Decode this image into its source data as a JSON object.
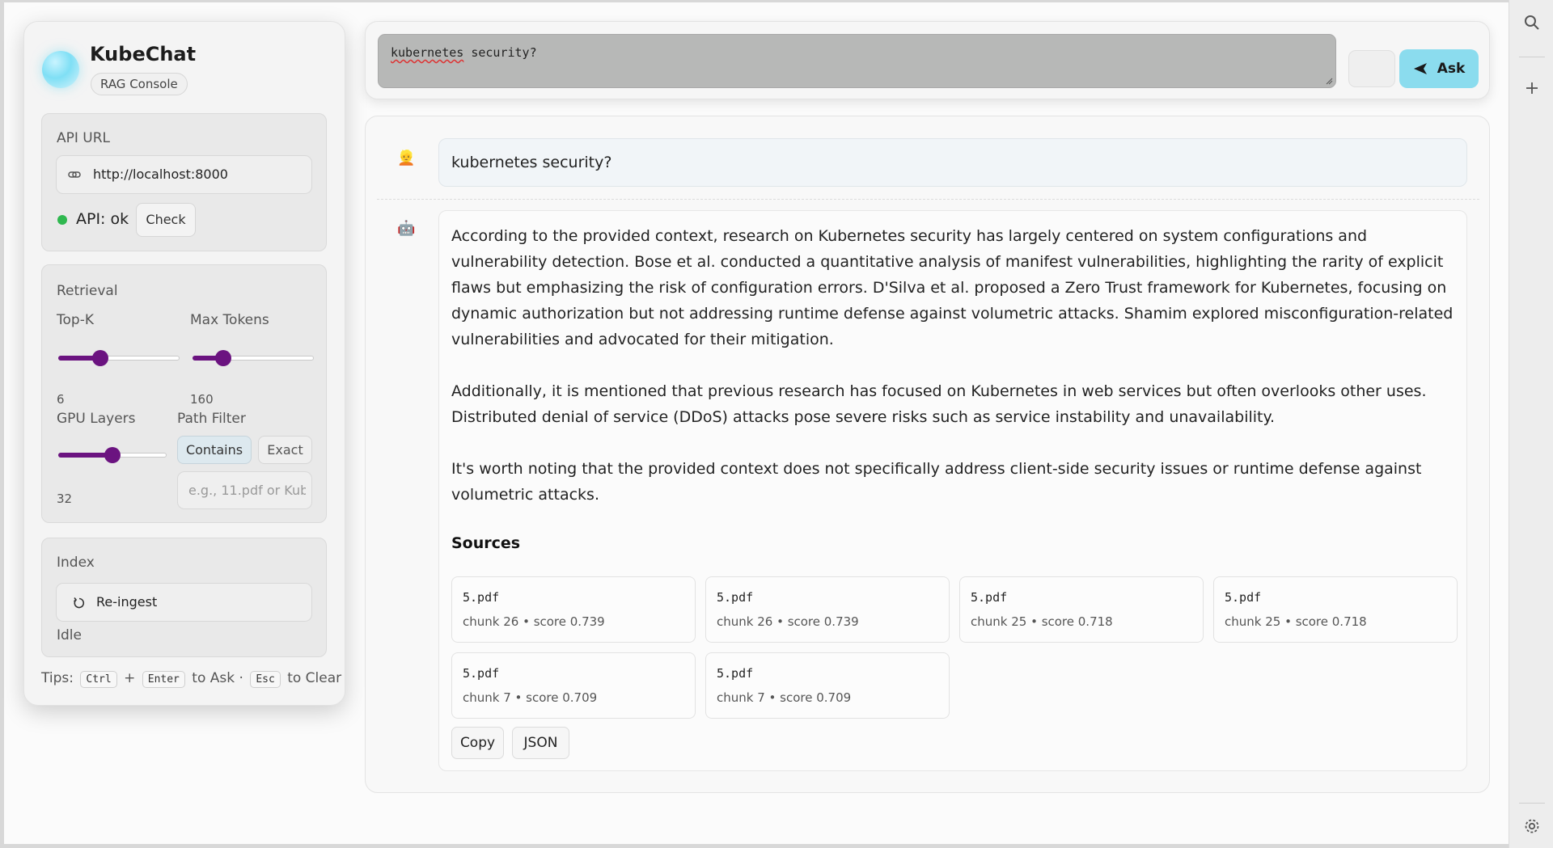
{
  "brand": {
    "title": "KubeChat",
    "badge": "RAG Console"
  },
  "api": {
    "section_title": "API URL",
    "url": "http://localhost:8000",
    "status": "API: ok",
    "status_color": "#2fb84f",
    "check_label": "Check"
  },
  "retrieval": {
    "section_title": "Retrieval",
    "topk": {
      "label": "Top-K",
      "value": "6",
      "level": 0.35
    },
    "max_tokens": {
      "label": "Max Tokens",
      "value": "160",
      "level": 0.25
    },
    "gpu_layers": {
      "label": "GPU Layers",
      "value": "32",
      "level": 0.5
    },
    "path_filter": {
      "label": "Path Filter",
      "contains_label": "Contains",
      "exact_label": "Exact",
      "placeholder": "e.g., 11.pdf or Kub"
    }
  },
  "index": {
    "section_title": "Index",
    "reingest_label": "Re-ingest",
    "status": "Idle"
  },
  "tips": {
    "prefix": "Tips:",
    "key1": "Ctrl",
    "plus": "+",
    "key2": "Enter",
    "ask_text": "to Ask ·",
    "key3": "Esc",
    "clear_text": "to Clear"
  },
  "query": {
    "word1": "kubernetes",
    "word2": " security?"
  },
  "ask_label": "Ask",
  "chat": {
    "user_message": "kubernetes security?",
    "answer": [
      "According to the provided context, research on Kubernetes security has largely centered on system configurations and vulnerability detection. Bose et al. conducted a quantitative analysis of manifest vulnerabilities, highlighting the rarity of explicit flaws but emphasizing the risk of configuration errors. D'Silva et al. proposed a Zero Trust framework for Kubernetes, focusing on dynamic authorization but not addressing runtime defense against volumetric attacks. Shamim explored misconfiguration-related vulnerabilities and advocated for their mitigation.",
      "Additionally, it is mentioned that previous research has focused on Kubernetes in web services but often overlooks other uses. Distributed denial of service (DDoS) attacks pose severe risks such as service instability and unavailability.",
      "It's worth noting that the provided context does not specifically address client-side security issues or runtime defense against volumetric attacks."
    ],
    "sources_title": "Sources",
    "sources": [
      {
        "file": "5.pdf",
        "meta": "chunk 26 • score 0.739"
      },
      {
        "file": "5.pdf",
        "meta": "chunk 26 • score 0.739"
      },
      {
        "file": "5.pdf",
        "meta": "chunk 25 • score 0.718"
      },
      {
        "file": "5.pdf",
        "meta": "chunk 25 • score 0.718"
      },
      {
        "file": "5.pdf",
        "meta": "chunk 7 • score 0.709"
      },
      {
        "file": "5.pdf",
        "meta": "chunk 7 • score 0.709"
      }
    ],
    "copy_label": "Copy",
    "json_label": "JSON"
  },
  "icons": {
    "rail": [
      "search-icon",
      "plus-icon",
      "gear-icon"
    ],
    "user_avatar": "👱",
    "bot_avatar": "🤖"
  },
  "colors": {
    "accent": "#6b1380",
    "ask_button": "#8bdcee"
  }
}
